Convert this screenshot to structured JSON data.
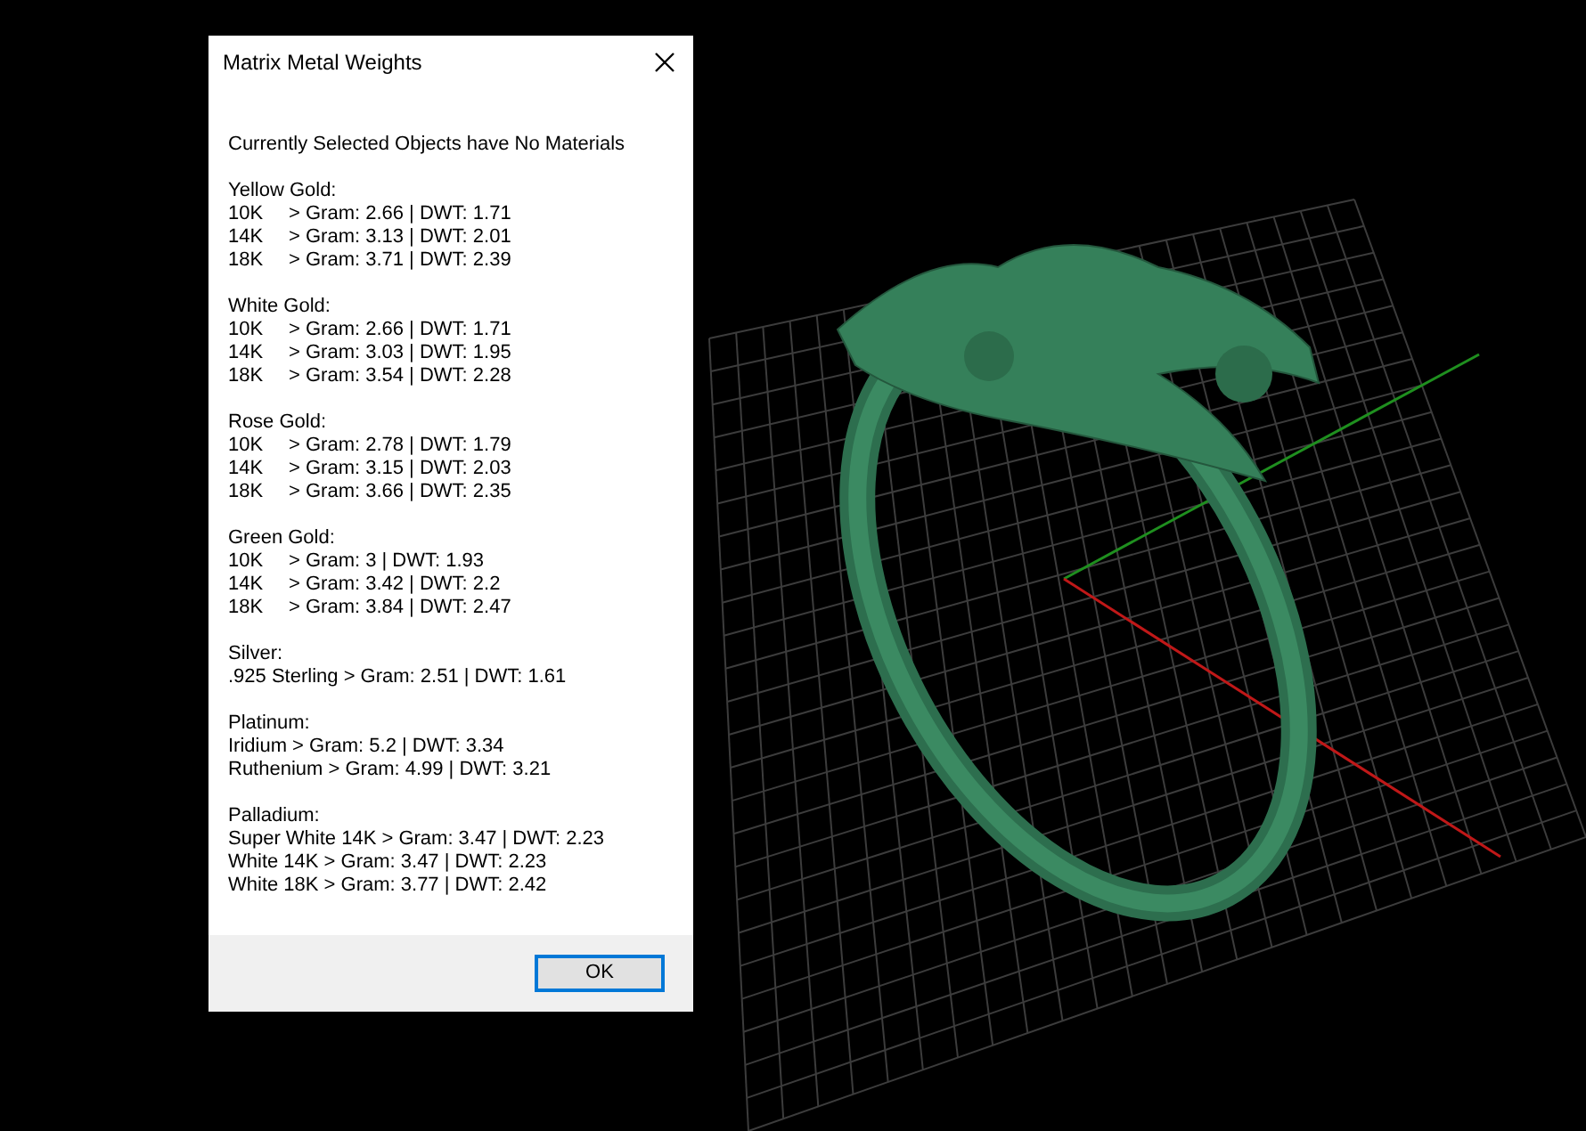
{
  "dialog": {
    "title": "Matrix Metal Weights",
    "message": "Currently Selected Objects have No Materials",
    "groups": [
      {
        "heading": "Yellow Gold:",
        "lines": [
          {
            "kind": "karat",
            "label": "10K",
            "value": "> Gram: 2.66 | DWT: 1.71"
          },
          {
            "kind": "karat",
            "label": "14K",
            "value": "> Gram: 3.13 | DWT: 2.01"
          },
          {
            "kind": "karat",
            "label": "18K",
            "value": "> Gram: 3.71 | DWT: 2.39"
          }
        ]
      },
      {
        "heading": "White Gold:",
        "lines": [
          {
            "kind": "karat",
            "label": "10K",
            "value": "> Gram: 2.66 | DWT: 1.71"
          },
          {
            "kind": "karat",
            "label": "14K",
            "value": "> Gram: 3.03 | DWT: 1.95"
          },
          {
            "kind": "karat",
            "label": "18K",
            "value": "> Gram: 3.54 | DWT: 2.28"
          }
        ]
      },
      {
        "heading": "Rose Gold:",
        "lines": [
          {
            "kind": "karat",
            "label": "10K",
            "value": "> Gram: 2.78 | DWT: 1.79"
          },
          {
            "kind": "karat",
            "label": "14K",
            "value": "> Gram: 3.15 | DWT: 2.03"
          },
          {
            "kind": "karat",
            "label": "18K",
            "value": "> Gram: 3.66 | DWT: 2.35"
          }
        ]
      },
      {
        "heading": "Green Gold:",
        "lines": [
          {
            "kind": "karat",
            "label": "10K",
            "value": "> Gram: 3 | DWT: 1.93"
          },
          {
            "kind": "karat",
            "label": "14K",
            "value": "> Gram: 3.42 | DWT: 2.2"
          },
          {
            "kind": "karat",
            "label": "18K",
            "value": "> Gram: 3.84 | DWT: 2.47"
          }
        ]
      },
      {
        "heading": "Silver:",
        "lines": [
          {
            "kind": "line",
            "text": ".925 Sterling > Gram: 2.51 | DWT: 1.61"
          }
        ]
      },
      {
        "heading": "Platinum:",
        "lines": [
          {
            "kind": "line",
            "text": "Iridium > Gram: 5.2 | DWT: 3.34"
          },
          {
            "kind": "line",
            "text": "Ruthenium > Gram: 4.99 | DWT: 3.21"
          }
        ]
      },
      {
        "heading": "Palladium:",
        "lines": [
          {
            "kind": "line",
            "text": "Super White 14K > Gram: 3.47 | DWT: 2.23"
          },
          {
            "kind": "line",
            "text": "White 14K > Gram: 3.47 | DWT: 2.23"
          },
          {
            "kind": "line",
            "text": "White 18K > Gram: 3.77 | DWT: 2.42"
          }
        ]
      }
    ],
    "ok_button": "OK"
  }
}
